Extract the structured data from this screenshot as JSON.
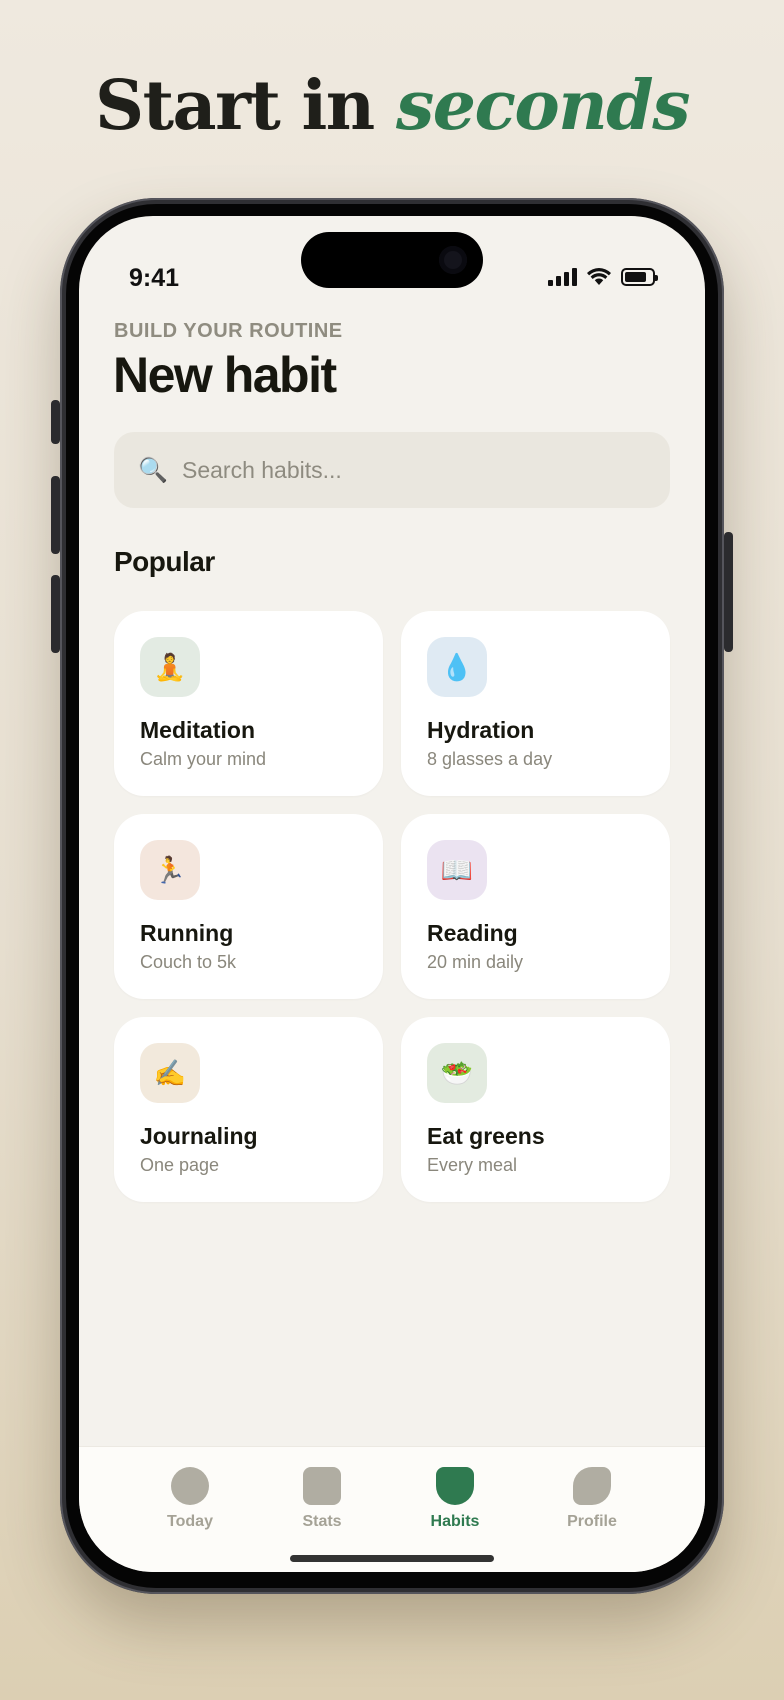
{
  "headline": {
    "prefix": "Start in",
    "accent": "seconds"
  },
  "status": {
    "time": "9:41"
  },
  "header": {
    "eyebrow": "BUILD YOUR ROUTINE",
    "title": "New habit"
  },
  "search": {
    "placeholder": "Search habits...",
    "icon": "magnifier-icon"
  },
  "section_title": "Popular",
  "habits": [
    {
      "name": "Meditation",
      "subtitle": "Calm your mind",
      "emoji": "🧘",
      "icon_bg": "#e3ebe3"
    },
    {
      "name": "Hydration",
      "subtitle": "8 glasses a day",
      "emoji": "💧",
      "icon_bg": "#dfeaf3"
    },
    {
      "name": "Running",
      "subtitle": "Couch to 5k",
      "emoji": "🏃",
      "icon_bg": "#f4e6dd"
    },
    {
      "name": "Reading",
      "subtitle": "20 min daily",
      "emoji": "📖",
      "icon_bg": "#ebe3f1"
    },
    {
      "name": "Journaling",
      "subtitle": "One page",
      "emoji": "✍️",
      "icon_bg": "#f2e9dc"
    },
    {
      "name": "Eat greens",
      "subtitle": "Every meal",
      "emoji": "🥗",
      "icon_bg": "#e3ebe0"
    }
  ],
  "tabs": [
    {
      "label": "Today",
      "active": false
    },
    {
      "label": "Stats",
      "active": false
    },
    {
      "label": "Habits",
      "active": true
    },
    {
      "label": "Profile",
      "active": false
    }
  ],
  "colors": {
    "accent": "#2f7a50",
    "inactive_tab": "#b0ada2",
    "screen_bg": "#f4f2ed"
  }
}
